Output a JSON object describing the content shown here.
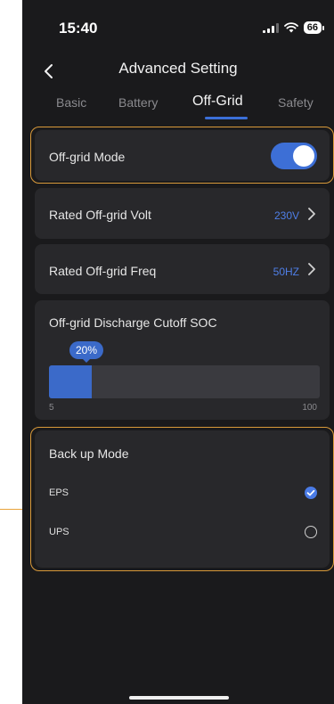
{
  "status": {
    "time": "15:40",
    "battery": "66"
  },
  "header": {
    "title": "Advanced Setting"
  },
  "tabs": [
    {
      "label": "Basic"
    },
    {
      "label": "Battery"
    },
    {
      "label": "Off-Grid"
    },
    {
      "label": "Safety"
    }
  ],
  "off_grid_mode": {
    "label": "Off-grid Mode",
    "enabled": true
  },
  "rated_volt": {
    "label": "Rated Off-grid Volt",
    "value": "230V"
  },
  "rated_freq": {
    "label": "Rated Off-grid Freq",
    "value": "50HZ"
  },
  "discharge": {
    "label": "Off-grid Discharge Cutoff SOC",
    "value_label": "20%",
    "value": 20,
    "min": "5",
    "max": "100"
  },
  "backup": {
    "title": "Back up Mode",
    "options": [
      {
        "label": "EPS",
        "selected": true
      },
      {
        "label": "UPS",
        "selected": false
      }
    ]
  },
  "colors": {
    "accent": "#3b6fd8",
    "highlight": "#d99a3a",
    "card": "#28282b",
    "background": "#1a1a1c"
  }
}
